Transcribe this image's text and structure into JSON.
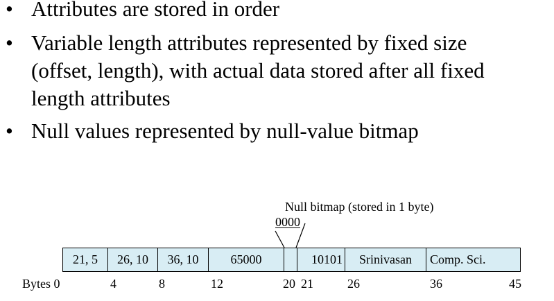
{
  "bullets": [
    {
      "symbol": "•",
      "lines": [
        "Attributes are stored in order"
      ]
    },
    {
      "symbol": "•",
      "lines": [
        "Variable length attributes represented by fixed size",
        "(offset, length), with actual data stored after all fixed",
        "length attributes"
      ]
    },
    {
      "symbol": "•",
      "lines": [
        "Null values represented by null-value bitmap"
      ]
    }
  ],
  "diagram": {
    "null_bitmap_label": "Null bitmap (stored in 1 byte)",
    "null_bitmap_value": "0000",
    "record_fields": [
      "21, 5",
      "26, 10",
      "36, 10",
      "65000",
      "",
      "10101",
      "Srinivasan",
      "Comp. Sci."
    ],
    "bytes_label": "Bytes",
    "byte_offsets": [
      "0",
      "4",
      "8",
      "12",
      "20",
      "21",
      "26",
      "36",
      "45"
    ]
  }
}
